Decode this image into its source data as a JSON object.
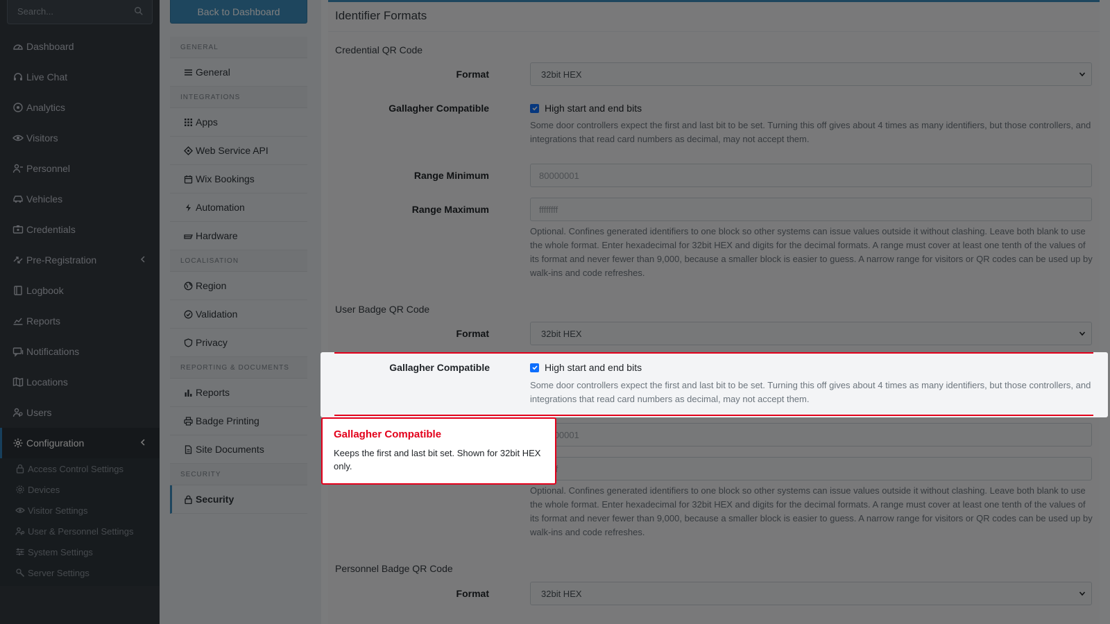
{
  "sidebar": {
    "search_placeholder": "Search...",
    "items": [
      {
        "label": "Dashboard",
        "icon": "dashboard-icon"
      },
      {
        "label": "Live Chat",
        "icon": "headset-icon"
      },
      {
        "label": "Analytics",
        "icon": "target-icon"
      },
      {
        "label": "Visitors",
        "icon": "eye-icon"
      },
      {
        "label": "Personnel",
        "icon": "person-icon"
      },
      {
        "label": "Vehicles",
        "icon": "car-icon"
      },
      {
        "label": "Credentials",
        "icon": "id-card-icon"
      },
      {
        "label": "Pre-Registration",
        "icon": "arrows-icon"
      },
      {
        "label": "Logbook",
        "icon": "book-icon"
      },
      {
        "label": "Reports",
        "icon": "chart-icon"
      },
      {
        "label": "Notifications",
        "icon": "message-icon"
      },
      {
        "label": "Locations",
        "icon": "map-icon"
      },
      {
        "label": "Users",
        "icon": "users-icon"
      },
      {
        "label": "Configuration",
        "icon": "gear-icon"
      }
    ],
    "sub_items": [
      {
        "label": "Access Control Settings"
      },
      {
        "label": "Devices"
      },
      {
        "label": "Visitor Settings"
      },
      {
        "label": "User & Personnel Settings"
      },
      {
        "label": "System Settings"
      },
      {
        "label": "Server Settings"
      }
    ]
  },
  "settings_menu": {
    "back_label": "Back to Dashboard",
    "sections": [
      {
        "heading": "GENERAL",
        "items": [
          "General"
        ]
      },
      {
        "heading": "INTEGRATIONS",
        "items": [
          "Apps",
          "Web Service API",
          "Wix Bookings",
          "Automation",
          "Hardware"
        ]
      },
      {
        "heading": "LOCALISATION",
        "items": [
          "Region",
          "Validation",
          "Privacy"
        ]
      },
      {
        "heading": "REPORTING & DOCUMENTS",
        "items": [
          "Reports",
          "Badge Printing",
          "Site Documents"
        ]
      },
      {
        "heading": "SECURITY",
        "items": [
          "Security"
        ]
      }
    ]
  },
  "main": {
    "title": "Identifier Formats",
    "format_label": "Format",
    "gallagher_label": "Gallagher Compatible",
    "range_min_label": "Range Minimum",
    "range_max_label": "Range Maximum",
    "checkbox_text": "High start and end bits",
    "gallagher_help": "Some door controllers expect the first and last bit to be set. Turning this off gives about 4 times as many identifiers, but those controllers, and integrations that read card numbers as decimal, may not accept them.",
    "range_help": "Optional. Confines generated identifiers to one block so other systems can issue values outside it without clashing. Leave both blank to use the whole format. Enter hexadecimal for 32bit HEX and digits for the decimal formats. A range must cover at least one tenth of the values of its format and never fewer than 9,000, because a smaller block is easier to guess. A narrow range for visitors or QR codes can be used up by walk-ins and code refreshes.",
    "sections": [
      {
        "title": "Credential QR Code",
        "format": "32bit HEX",
        "range_min_placeholder": "80000001",
        "range_max_placeholder": "ffffffff"
      },
      {
        "title": "User Badge QR Code",
        "format": "32bit HEX",
        "range_min_placeholder": "80000001",
        "range_max_placeholder": "ffffffff"
      },
      {
        "title": "Personnel Badge QR Code",
        "format": "32bit HEX"
      }
    ]
  },
  "tooltip": {
    "title": "Gallagher Compatible",
    "body": "Keeps the first and last bit set. Shown for 32bit HEX only."
  },
  "colors": {
    "accent": "#3c8dbc",
    "highlight_red": "#e3001b",
    "sidebar_bg": "#343a40"
  }
}
